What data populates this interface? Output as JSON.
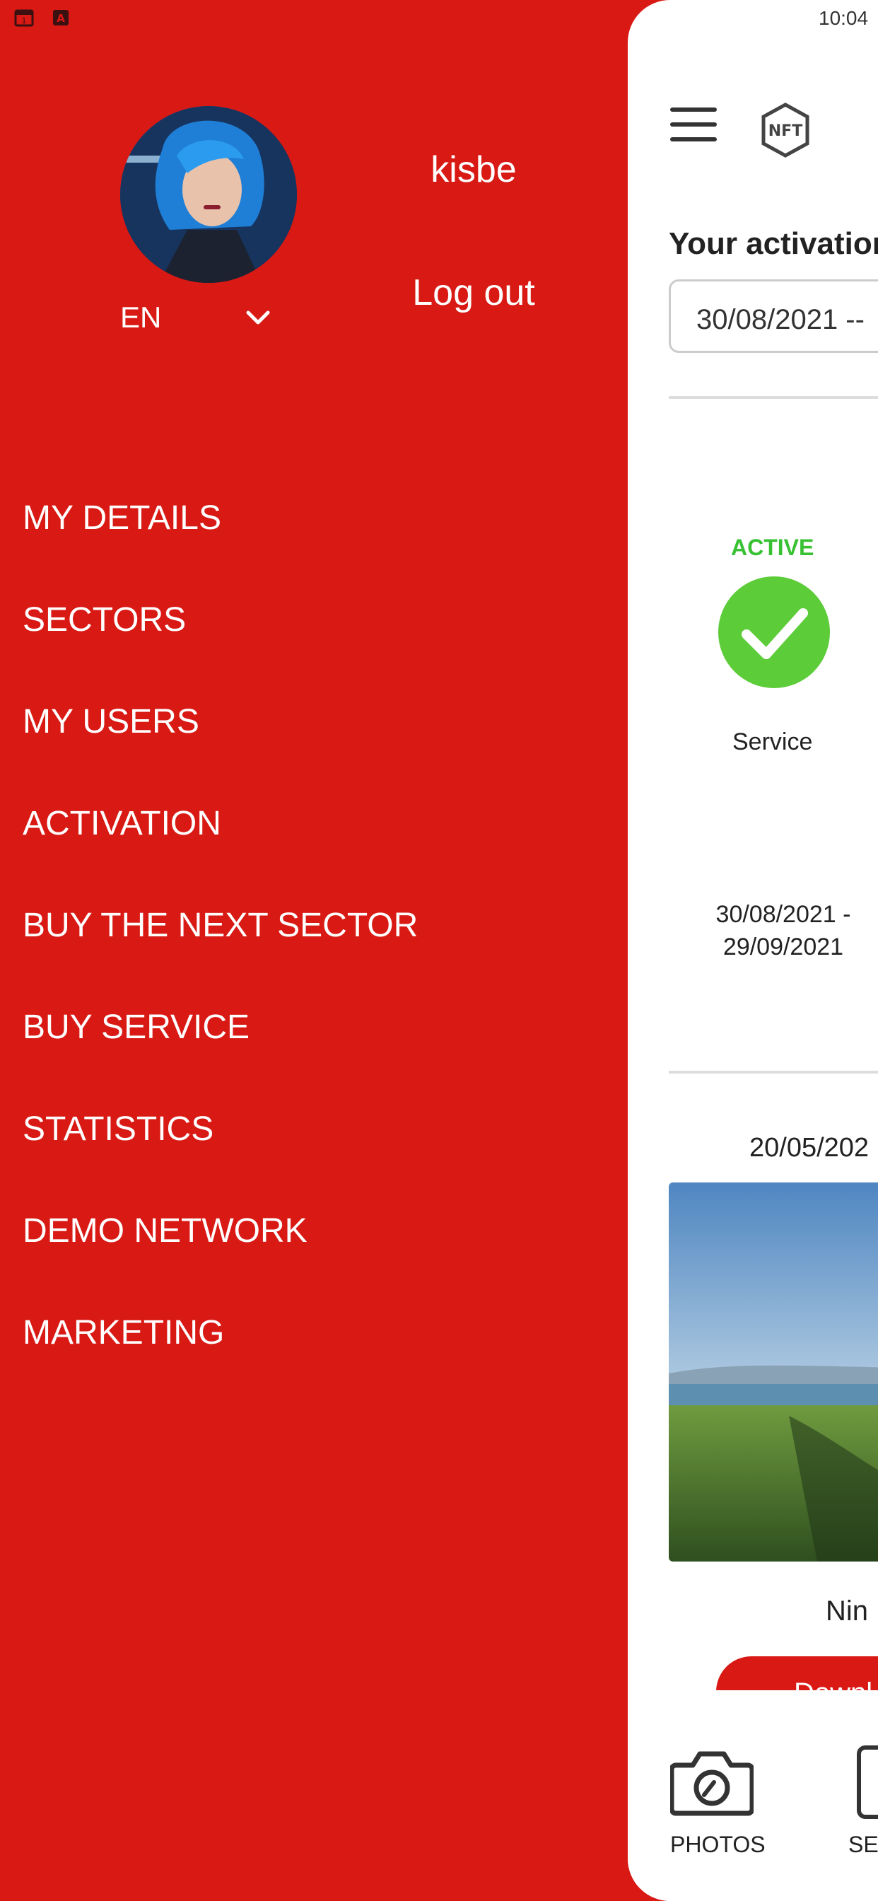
{
  "status_bar": {
    "time": "10:04"
  },
  "profile": {
    "username": "kisbe",
    "logout_label": "Log out",
    "language": "EN"
  },
  "menu": {
    "items": [
      {
        "label": "MY DETAILS"
      },
      {
        "label": "SECTORS"
      },
      {
        "label": "MY USERS"
      },
      {
        "label": "ACTIVATION"
      },
      {
        "label": "BUY THE NEXT SECTOR"
      },
      {
        "label": "BUY SERVICE"
      },
      {
        "label": "STATISTICS"
      },
      {
        "label": "DEMO NETWORK"
      },
      {
        "label": "MARKETING"
      }
    ]
  },
  "main": {
    "logo_text": "NFT",
    "activation_title": "Your activation",
    "date_range_selected": "30/08/2021 --",
    "service_status": "ACTIVE",
    "service_label": "Service",
    "service_dates": "30/08/2021 - 29/09/2021",
    "post_date": "20/05/202",
    "post_caption": "Nin",
    "download_label": "Downl"
  },
  "bottom_nav": {
    "photos_label": "PHOTOS",
    "search_label": "SEA"
  },
  "colors": {
    "drawer_red": "#d91914",
    "active_green": "#38c133",
    "check_green": "#5ccc39"
  }
}
